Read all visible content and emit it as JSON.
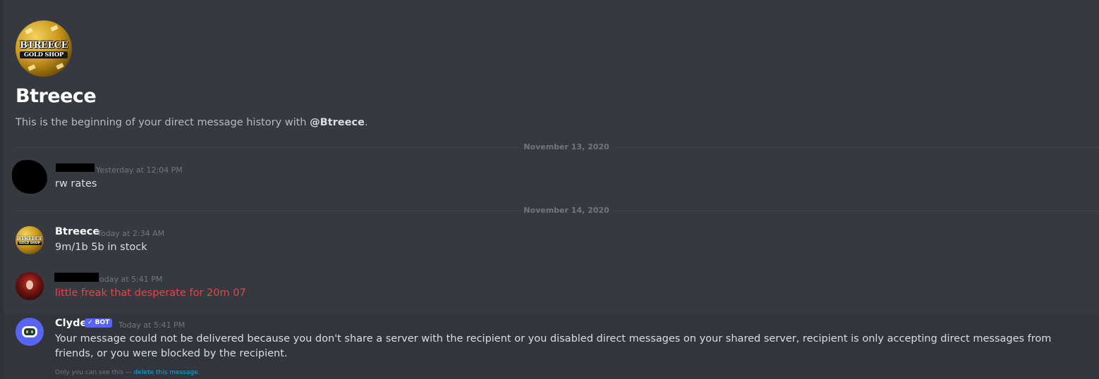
{
  "header": {
    "logo_top": "BTREECE",
    "logo_bottom": "GOLD SHOP",
    "title": "Btreece",
    "intro_prefix": "This is the beginning of your direct message history with ",
    "intro_mention": "@Btreece",
    "intro_suffix": "."
  },
  "dividers": [
    {
      "label": "November 13, 2020"
    },
    {
      "label": "November 14, 2020"
    }
  ],
  "messages": [
    {
      "username": "",
      "timestamp": "Yesterday at 12:04 PM",
      "text": "rw rates"
    },
    {
      "username": "Btreece",
      "timestamp": "Today at 2:34 AM",
      "text": "9m/1b 5b in stock",
      "avatar_top": "BTREECE",
      "avatar_bottom": "GOLD SHOP"
    },
    {
      "username": "",
      "timestamp": "oday at 5:41 PM",
      "text": "little freak that desperate for 20m 07"
    },
    {
      "username": "Clyde",
      "badge": "✓ BOT",
      "timestamp": "Today at 5:41 PM",
      "text": "Your message could not be delivered because you don't share a server with the recipient or you disabled direct messages on your shared server, recipient is only accepting direct messages from friends, or you were blocked by the recipient.",
      "note_prefix": "Only you can see this — ",
      "note_link": "delete this message",
      "note_suffix": "."
    }
  ],
  "colors": {
    "background": "#36393f",
    "accent": "#5865f2",
    "error_text": "#ed4245",
    "link": "#00aff4"
  }
}
